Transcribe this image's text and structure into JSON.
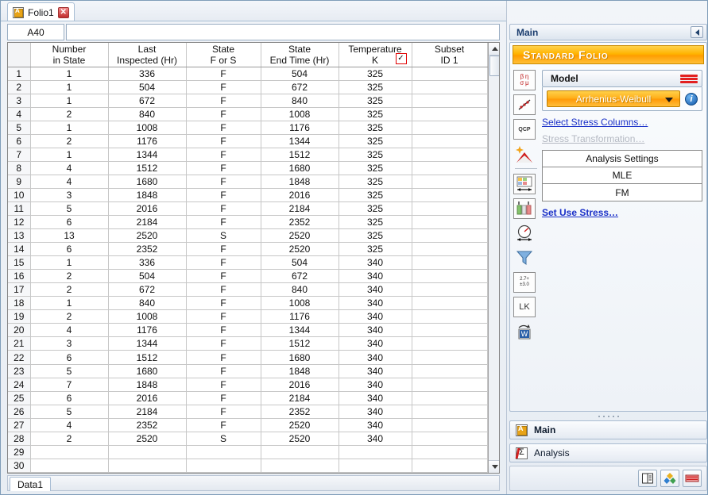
{
  "window": {
    "doc_tab_label": "Folio1",
    "close_label": "✕",
    "sheet_tab_label": "Data1"
  },
  "formula_bar": {
    "cell_ref": "A40",
    "formula_value": "",
    "formula_placeholder": ""
  },
  "sheet": {
    "columns": [
      {
        "line1": "",
        "line2": ""
      },
      {
        "line1": "Number",
        "line2": "in State"
      },
      {
        "line1": "Last",
        "line2": "Inspected (Hr)"
      },
      {
        "line1": "State",
        "line2": "F or S"
      },
      {
        "line1": "State",
        "line2": "End Time (Hr)"
      },
      {
        "line1": "Temperature",
        "line2": "K"
      },
      {
        "line1": "Subset",
        "line2": "ID 1"
      }
    ],
    "temperature_header_checkbox": "✓",
    "rows": [
      {
        "n": "1",
        "number_in_state": "1",
        "last_inspected": "336",
        "state": "F",
        "end_time": "504",
        "temperature": "325",
        "subset": ""
      },
      {
        "n": "2",
        "number_in_state": "1",
        "last_inspected": "504",
        "state": "F",
        "end_time": "672",
        "temperature": "325",
        "subset": ""
      },
      {
        "n": "3",
        "number_in_state": "1",
        "last_inspected": "672",
        "state": "F",
        "end_time": "840",
        "temperature": "325",
        "subset": ""
      },
      {
        "n": "4",
        "number_in_state": "2",
        "last_inspected": "840",
        "state": "F",
        "end_time": "1008",
        "temperature": "325",
        "subset": ""
      },
      {
        "n": "5",
        "number_in_state": "1",
        "last_inspected": "1008",
        "state": "F",
        "end_time": "1176",
        "temperature": "325",
        "subset": ""
      },
      {
        "n": "6",
        "number_in_state": "2",
        "last_inspected": "1176",
        "state": "F",
        "end_time": "1344",
        "temperature": "325",
        "subset": ""
      },
      {
        "n": "7",
        "number_in_state": "1",
        "last_inspected": "1344",
        "state": "F",
        "end_time": "1512",
        "temperature": "325",
        "subset": ""
      },
      {
        "n": "8",
        "number_in_state": "4",
        "last_inspected": "1512",
        "state": "F",
        "end_time": "1680",
        "temperature": "325",
        "subset": ""
      },
      {
        "n": "9",
        "number_in_state": "4",
        "last_inspected": "1680",
        "state": "F",
        "end_time": "1848",
        "temperature": "325",
        "subset": ""
      },
      {
        "n": "10",
        "number_in_state": "3",
        "last_inspected": "1848",
        "state": "F",
        "end_time": "2016",
        "temperature": "325",
        "subset": ""
      },
      {
        "n": "11",
        "number_in_state": "5",
        "last_inspected": "2016",
        "state": "F",
        "end_time": "2184",
        "temperature": "325",
        "subset": ""
      },
      {
        "n": "12",
        "number_in_state": "6",
        "last_inspected": "2184",
        "state": "F",
        "end_time": "2352",
        "temperature": "325",
        "subset": ""
      },
      {
        "n": "13",
        "number_in_state": "13",
        "last_inspected": "2520",
        "state": "S",
        "end_time": "2520",
        "temperature": "325",
        "subset": ""
      },
      {
        "n": "14",
        "number_in_state": "6",
        "last_inspected": "2352",
        "state": "F",
        "end_time": "2520",
        "temperature": "325",
        "subset": ""
      },
      {
        "n": "15",
        "number_in_state": "1",
        "last_inspected": "336",
        "state": "F",
        "end_time": "504",
        "temperature": "340",
        "subset": ""
      },
      {
        "n": "16",
        "number_in_state": "2",
        "last_inspected": "504",
        "state": "F",
        "end_time": "672",
        "temperature": "340",
        "subset": ""
      },
      {
        "n": "17",
        "number_in_state": "2",
        "last_inspected": "672",
        "state": "F",
        "end_time": "840",
        "temperature": "340",
        "subset": ""
      },
      {
        "n": "18",
        "number_in_state": "1",
        "last_inspected": "840",
        "state": "F",
        "end_time": "1008",
        "temperature": "340",
        "subset": ""
      },
      {
        "n": "19",
        "number_in_state": "2",
        "last_inspected": "1008",
        "state": "F",
        "end_time": "1176",
        "temperature": "340",
        "subset": ""
      },
      {
        "n": "20",
        "number_in_state": "4",
        "last_inspected": "1176",
        "state": "F",
        "end_time": "1344",
        "temperature": "340",
        "subset": ""
      },
      {
        "n": "21",
        "number_in_state": "3",
        "last_inspected": "1344",
        "state": "F",
        "end_time": "1512",
        "temperature": "340",
        "subset": ""
      },
      {
        "n": "22",
        "number_in_state": "6",
        "last_inspected": "1512",
        "state": "F",
        "end_time": "1680",
        "temperature": "340",
        "subset": ""
      },
      {
        "n": "23",
        "number_in_state": "5",
        "last_inspected": "1680",
        "state": "F",
        "end_time": "1848",
        "temperature": "340",
        "subset": ""
      },
      {
        "n": "24",
        "number_in_state": "7",
        "last_inspected": "1848",
        "state": "F",
        "end_time": "2016",
        "temperature": "340",
        "subset": ""
      },
      {
        "n": "25",
        "number_in_state": "6",
        "last_inspected": "2016",
        "state": "F",
        "end_time": "2184",
        "temperature": "340",
        "subset": ""
      },
      {
        "n": "26",
        "number_in_state": "5",
        "last_inspected": "2184",
        "state": "F",
        "end_time": "2352",
        "temperature": "340",
        "subset": ""
      },
      {
        "n": "27",
        "number_in_state": "4",
        "last_inspected": "2352",
        "state": "F",
        "end_time": "2520",
        "temperature": "340",
        "subset": ""
      },
      {
        "n": "28",
        "number_in_state": "2",
        "last_inspected": "2520",
        "state": "S",
        "end_time": "2520",
        "temperature": "340",
        "subset": ""
      },
      {
        "n": "29",
        "number_in_state": "",
        "last_inspected": "",
        "state": "",
        "end_time": "",
        "temperature": "",
        "subset": ""
      },
      {
        "n": "30",
        "number_in_state": "",
        "last_inspected": "",
        "state": "",
        "end_time": "",
        "temperature": "",
        "subset": ""
      }
    ]
  },
  "panel": {
    "title": "Main",
    "banner": "Standard Folio",
    "model_label": "Model",
    "model_value": "Arrhenius-Weibull",
    "select_stress_columns": "Select Stress Columns…",
    "stress_transformation": "Stress Transformation…",
    "analysis_settings": "Analysis Settings",
    "analysis_method": "MLE",
    "analysis_rank": "FM",
    "set_use_stress": "Set Use Stress…",
    "rail_icons": [
      "parameters-icon",
      "plot-icon",
      "qcp-icon",
      "wizard-icon",
      "data-range-icon",
      "columns-icon",
      "gauge-icon",
      "filter-icon",
      "calculator-icon",
      "lk-icon",
      "word-export-icon"
    ],
    "rail_glyphs": [
      "βησμ",
      "↗",
      "QCP",
      "✦",
      "↔",
      "↕",
      "◔",
      "▽",
      "2.7+",
      "LK",
      "W"
    ],
    "sections": [
      {
        "label": "Main",
        "icon": "folio-icon"
      },
      {
        "label": "Analysis",
        "icon": "analysis-icon"
      }
    ],
    "footer_buttons": [
      "report-icon",
      "plot-color-icon",
      "sheet-icon"
    ]
  },
  "colors": {
    "accent_orange": "#ffae18",
    "highlight_red": "#e00000",
    "link_blue": "#1a30c8",
    "title_blue": "#1a3c6e"
  }
}
